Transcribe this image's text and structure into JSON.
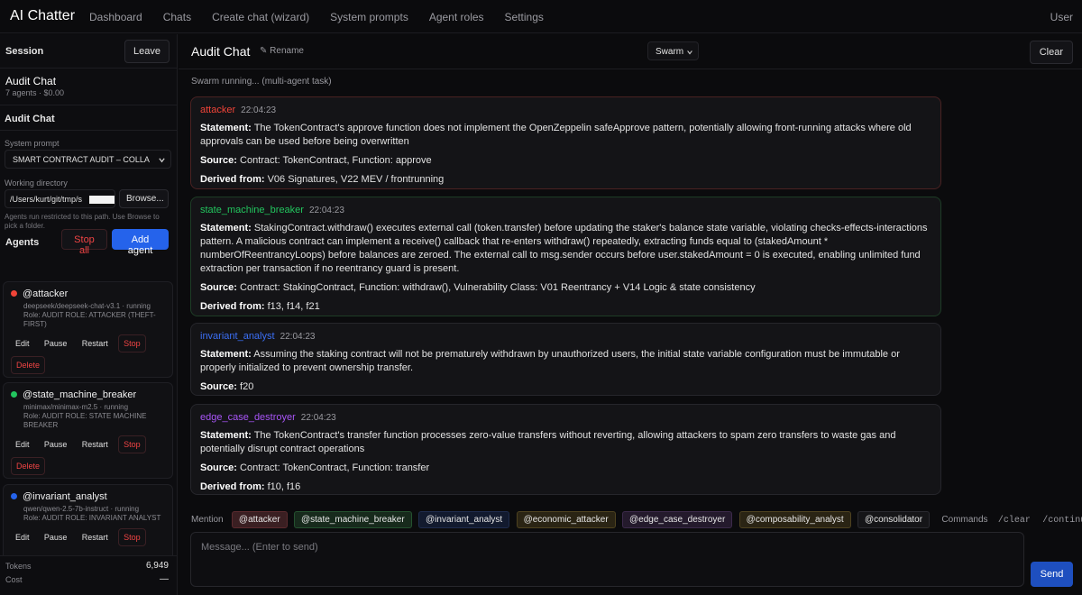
{
  "app": {
    "title": "AI Chatter",
    "user": "User"
  },
  "nav": [
    "Dashboard",
    "Chats",
    "Create chat (wizard)",
    "System prompts",
    "Agent roles",
    "Settings"
  ],
  "sidebar": {
    "session_label": "Session",
    "leave_label": "Leave",
    "chat_title": "Audit Chat",
    "chat_meta": "7 agents · $0.00",
    "chat_name": "Audit Chat",
    "system_prompt_label": "System prompt",
    "system_prompt_value": "SMART CONTRACT AUDIT – COLLA",
    "workdir_label": "Working directory",
    "workdir_value": "/Users/kurt/git/tmp/s",
    "browse_label": "Browse...",
    "workdir_hint": "Agents run restricted to this path. Use Browse to pick a folder.",
    "agents_label": "Agents",
    "stop_all_label": "Stop all",
    "add_agent_label": "Add agent",
    "agents": [
      {
        "name": "@attacker",
        "model": "deepseek/deepseek-chat-v3.1 · running",
        "role": "Role: AUDIT ROLE: ATTACKER (THEFT-FIRST)",
        "color": "#f04438"
      },
      {
        "name": "@state_machine_breaker",
        "model": "minimax/minimax-m2.5 · running",
        "role": "Role: AUDIT ROLE: STATE MACHINE BREAKER",
        "color": "#22c55e"
      },
      {
        "name": "@invariant_analyst",
        "model": "qwen/qwen-2.5-7b-instruct · running",
        "role": "Role: AUDIT ROLE: INVARIANT ANALYST",
        "color": "#2563eb"
      }
    ],
    "agent_actions": {
      "edit": "Edit",
      "pause": "Pause",
      "restart": "Restart",
      "stop": "Stop",
      "delete": "Delete"
    },
    "tokens_label": "Tokens",
    "tokens_value": "6,949",
    "cost_label": "Cost",
    "cost_value": "—"
  },
  "main": {
    "title": "Audit Chat",
    "rename_label": "Rename",
    "mode": "Swarm",
    "clear_label": "Clear",
    "status": "Swarm running... (multi-agent task)",
    "messages": [
      {
        "agent": "attacker",
        "time": "22:04:23",
        "color": "#f04438",
        "statement": "The TokenContract's approve function does not implement the OpenZeppelin safeApprove pattern, potentially allowing front-running attacks where old approvals can be used before being overwritten",
        "source": "Contract: TokenContract, Function: approve",
        "derived": "V06 Signatures, V22 MEV / frontrunning"
      },
      {
        "agent": "state_machine_breaker",
        "time": "22:04:23",
        "color": "#22c55e",
        "statement": "StakingContract.withdraw() executes external call (token.transfer) before updating the staker's balance state variable, violating checks-effects-interactions pattern. A malicious contract can implement a receive() callback that re-enters withdraw() repeatedly, extracting funds equal to (stakedAmount * numberOfReentrancyLoops) before balances are zeroed. The external call to msg.sender occurs before user.stakedAmount = 0 is executed, enabling unlimited fund extraction per transaction if no reentrancy guard is present.",
        "source": "Contract: StakingContract, Function: withdraw(), Vulnerability Class: V01 Reentrancy + V14 Logic & state consistency",
        "derived": "f13, f14, f21"
      },
      {
        "agent": "invariant_analyst",
        "time": "22:04:23",
        "color": "#3b6ff5",
        "statement": "Assuming the staking contract will not be prematurely withdrawn by unauthorized users, the initial state variable configuration must be immutable or properly initialized to prevent ownership transfer.",
        "source": "f20"
      },
      {
        "agent": "edge_case_destroyer",
        "time": "22:04:23",
        "color": "#a855f7",
        "statement": "The TokenContract's transfer function processes zero-value transfers without reverting, allowing attackers to spam zero transfers to waste gas and potentially disrupt contract operations",
        "source": "Contract: TokenContract, Function: transfer",
        "derived": "f10, f16"
      }
    ],
    "labels": {
      "statement": "Statement:",
      "source": "Source:",
      "derived": "Derived from:"
    },
    "mention_label": "Mention",
    "mentions": [
      {
        "label": "@attacker",
        "color": "#3a1f22",
        "border": "#5a2a2e"
      },
      {
        "label": "@state_machine_breaker",
        "color": "#172a1c",
        "border": "#24512f"
      },
      {
        "label": "@invariant_analyst",
        "color": "#121a2e",
        "border": "#1f2c4d"
      },
      {
        "label": "@economic_attacker",
        "color": "#2a2414",
        "border": "#4e4220"
      },
      {
        "label": "@edge_case_destroyer",
        "color": "#241a2c",
        "border": "#3c2a4a"
      },
      {
        "label": "@composability_analyst",
        "color": "#2a2414",
        "border": "#4e4220"
      },
      {
        "label": "@consolidator",
        "color": "#151518",
        "border": "#2a2a30"
      }
    ],
    "commands_label": "Commands",
    "commands": [
      "/clear",
      "/continue"
    ],
    "input_placeholder": "Message... (Enter to send)",
    "send_label": "Send"
  }
}
